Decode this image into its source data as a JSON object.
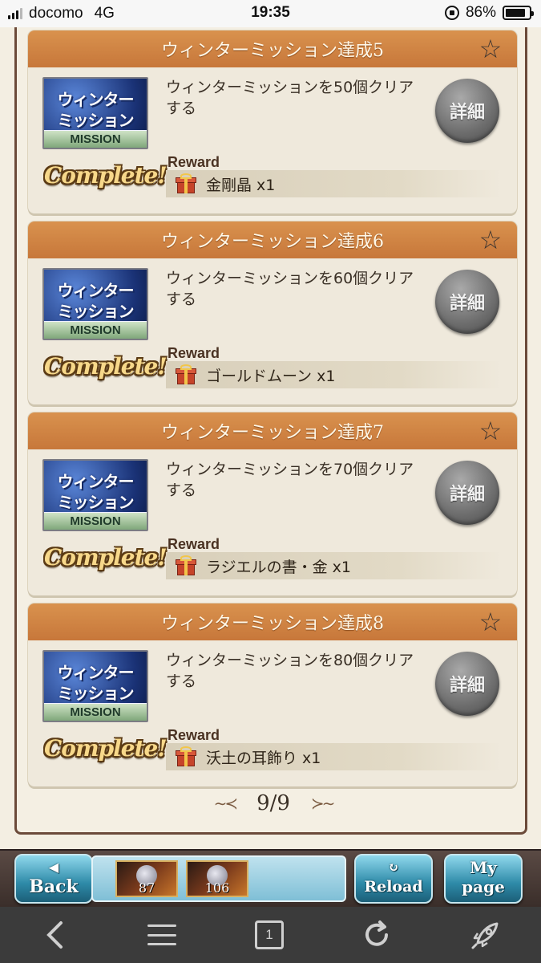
{
  "status_bar": {
    "carrier": "docomo",
    "network": "4G",
    "time": "19:35",
    "battery": "86%",
    "battery_level": 0.86
  },
  "missions": [
    {
      "title": "ウィンターミッション達成5",
      "badge_line1": "ウィンター",
      "badge_line2": "ミッション",
      "badge_band": "MISSION",
      "complete_label": "Complete!",
      "description": "ウィンターミッションを50個クリアする",
      "detail_label": "詳細",
      "reward_label": "Reward",
      "reward_item": "金剛晶 x1"
    },
    {
      "title": "ウィンターミッション達成6",
      "badge_line1": "ウィンター",
      "badge_line2": "ミッション",
      "badge_band": "MISSION",
      "complete_label": "Complete!",
      "description": "ウィンターミッションを60個クリアする",
      "detail_label": "詳細",
      "reward_label": "Reward",
      "reward_item": "ゴールドムーン x1"
    },
    {
      "title": "ウィンターミッション達成7",
      "badge_line1": "ウィンター",
      "badge_line2": "ミッション",
      "badge_band": "MISSION",
      "complete_label": "Complete!",
      "description": "ウィンターミッションを70個クリアする",
      "detail_label": "詳細",
      "reward_label": "Reward",
      "reward_item": "ラジエルの書・金 x1"
    },
    {
      "title": "ウィンターミッション達成8",
      "badge_line1": "ウィンター",
      "badge_line2": "ミッション",
      "badge_band": "MISSION",
      "complete_label": "Complete!",
      "description": "ウィンターミッションを80個クリアする",
      "detail_label": "詳細",
      "reward_label": "Reward",
      "reward_item": "沃土の耳飾り x1"
    }
  ],
  "pager": {
    "text": "9/9"
  },
  "game_nav": {
    "back_icon": "◀",
    "back_label": "Back",
    "reload_icon": "↻",
    "reload_label": "Reload",
    "mypage_label1": "My",
    "mypage_label2": "page",
    "party": [
      {
        "level": "87"
      },
      {
        "level": "106"
      }
    ]
  },
  "browser_toolbar": {
    "tab_count": "1"
  }
}
